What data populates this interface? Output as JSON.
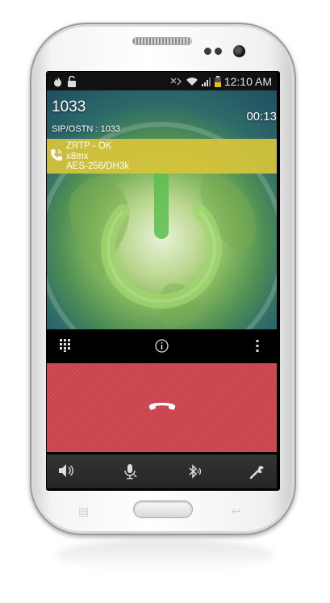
{
  "statusbar": {
    "time": "12:10 AM",
    "icons": [
      "fire-icon",
      "unlock-icon",
      "bluetooth-mute-icon",
      "wifi-icon",
      "signal-icon",
      "battery-icon"
    ]
  },
  "call": {
    "number": "1033",
    "sip_label": "SIP/OSTN : 1033",
    "timer": "00:13"
  },
  "zrtp": {
    "status": "ZRTP - OK",
    "sas": "x8mx",
    "cipher": "AES-256/DH3k"
  },
  "controls": {
    "icons": [
      "keypad-icon",
      "info-icon",
      "more-vert-icon"
    ]
  },
  "end_call": {
    "icon": "hang-up-icon",
    "color": "#d14b54"
  },
  "bottom_bar": {
    "icons": [
      "speaker-icon",
      "microphone-icon",
      "bluetooth-icon",
      "wrench-icon"
    ]
  },
  "colors": {
    "zrtp_banner": "#d6c43a",
    "end_call": "#d14b54",
    "bottom_bar": "#2e2e2e"
  }
}
